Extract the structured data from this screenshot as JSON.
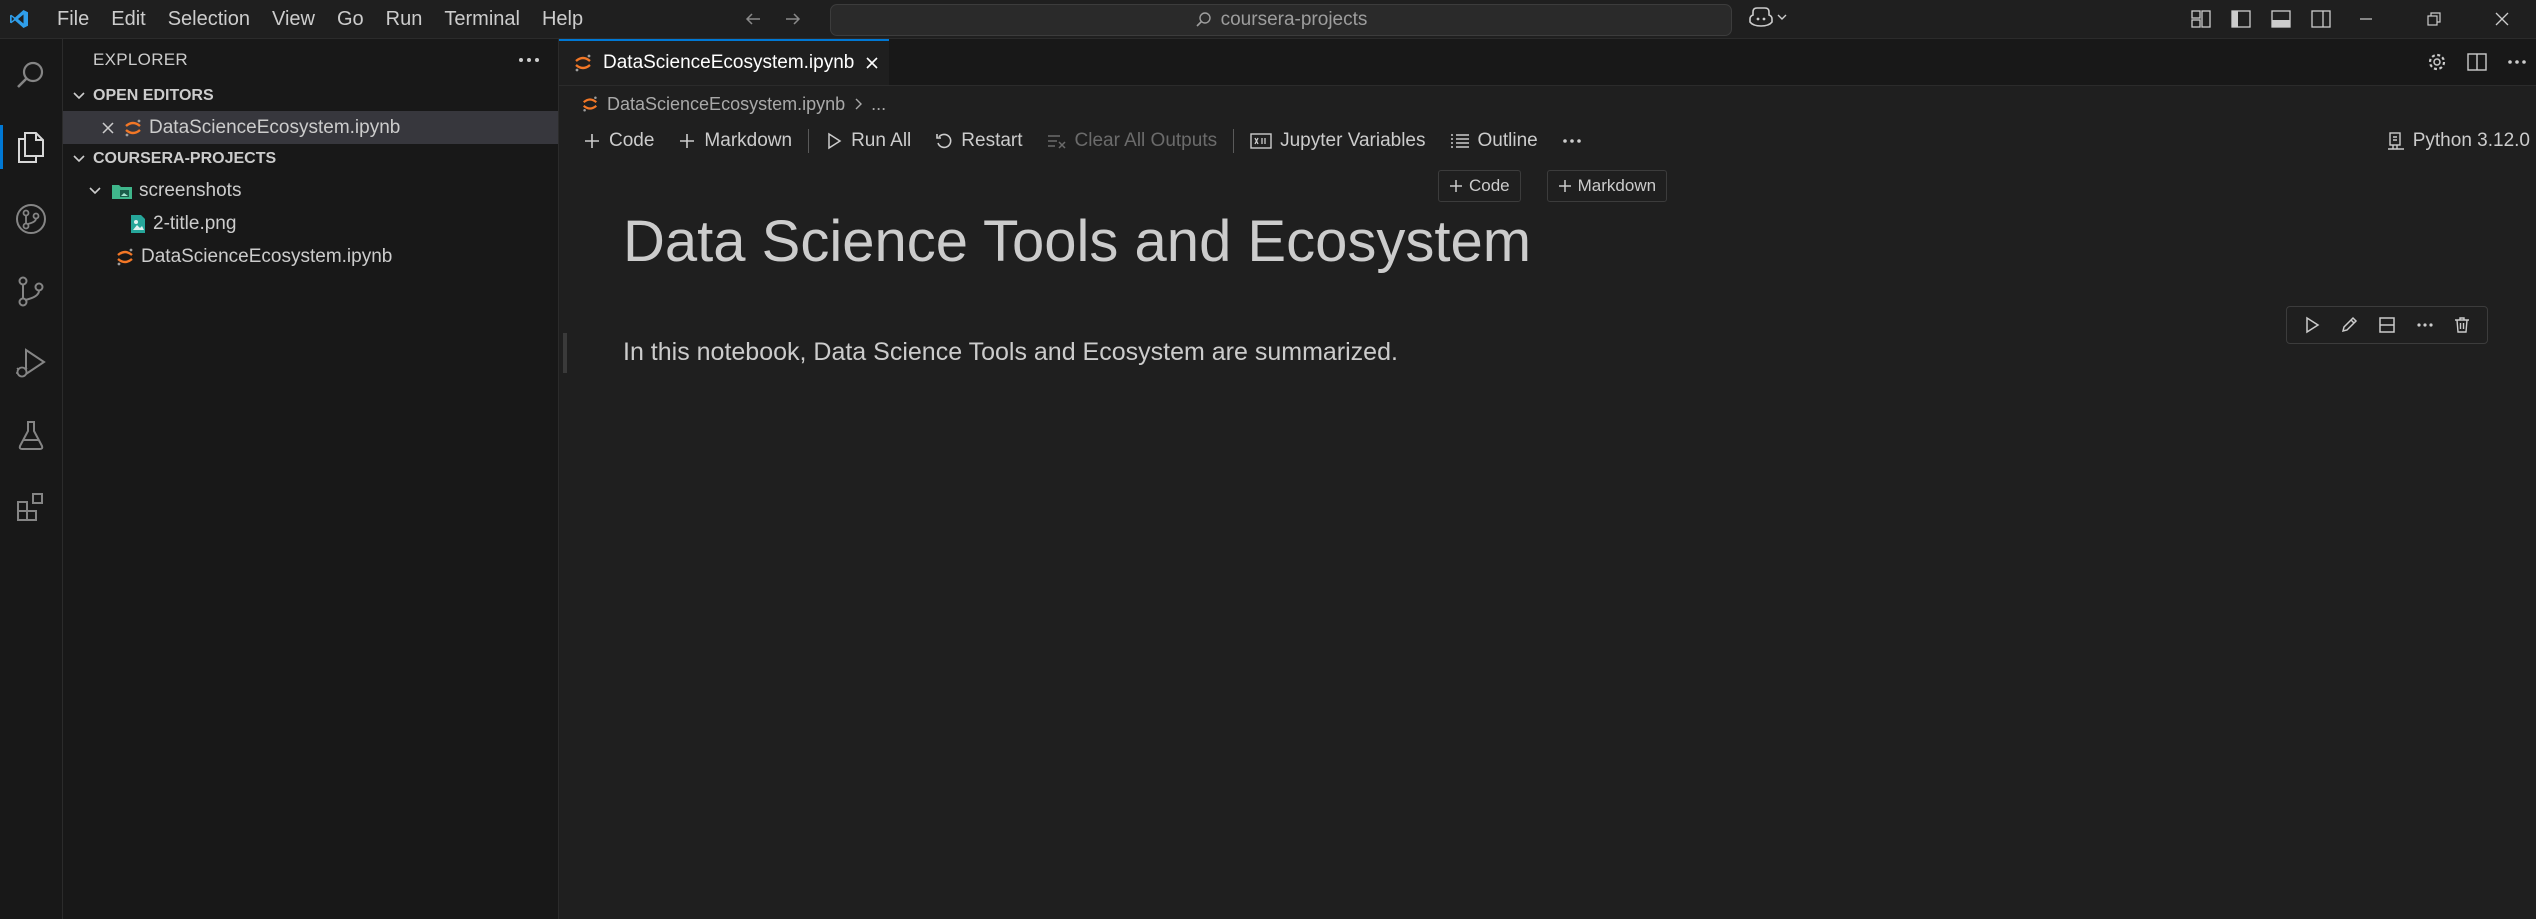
{
  "menu": [
    "File",
    "Edit",
    "Selection",
    "View",
    "Go",
    "Run",
    "Terminal",
    "Help"
  ],
  "command_center": {
    "text": "coursera-projects"
  },
  "sidebar": {
    "title": "EXPLORER",
    "open_editors": {
      "title": "OPEN EDITORS",
      "items": [
        {
          "label": "DataScienceEcosystem.ipynb",
          "selected": true
        }
      ]
    },
    "workspace": {
      "title": "COURSERA-PROJECTS",
      "folder": {
        "label": "screenshots",
        "expanded": true,
        "children": [
          {
            "label": "2-title.png"
          }
        ]
      },
      "files": [
        {
          "label": "DataScienceEcosystem.ipynb"
        }
      ]
    }
  },
  "editor": {
    "tab": {
      "label": "DataScienceEcosystem.ipynb"
    },
    "breadcrumb": {
      "file": "DataScienceEcosystem.ipynb",
      "rest": "..."
    },
    "toolbar": {
      "code": "Code",
      "markdown": "Markdown",
      "run_all": "Run All",
      "restart": "Restart",
      "clear_outputs": "Clear All Outputs",
      "variables": "Jupyter Variables",
      "outline": "Outline"
    },
    "kernel": "Python 3.12.0",
    "insert": {
      "code": "Code",
      "markdown": "Markdown"
    },
    "cell": {
      "heading": "Data Science Tools and Ecosystem",
      "paragraph": "In this notebook, Data Science Tools and Ecosystem are summarized."
    }
  },
  "colors": {
    "accent": "#0078d4",
    "jupyter_orange": "#f37726",
    "folder_green": "#3fb68b",
    "image_teal": "#26a69a"
  }
}
